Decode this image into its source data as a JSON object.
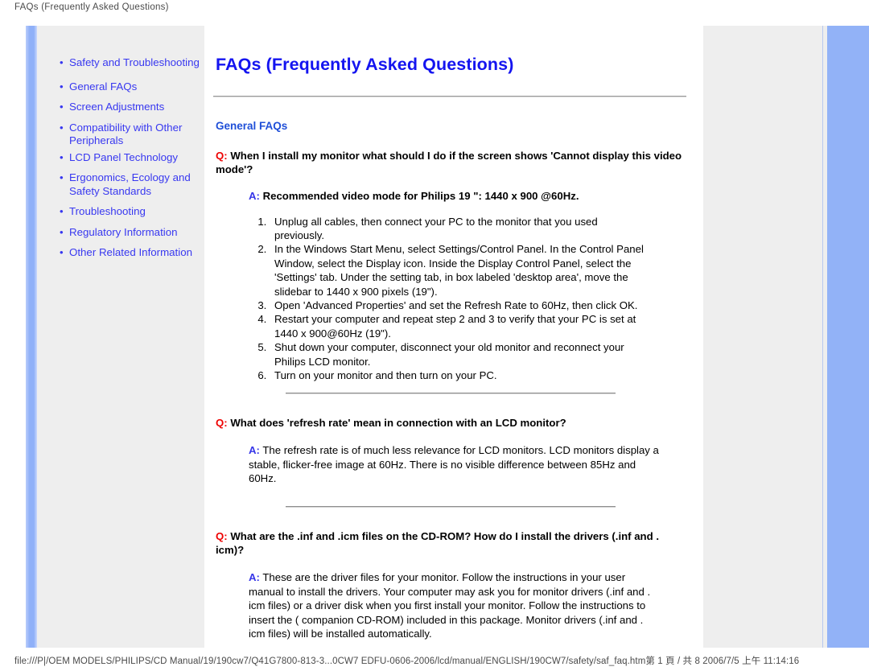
{
  "browser_header": {
    "title": "FAQs (Frequently Asked Questions)"
  },
  "sidebar": {
    "bullet_glyph": "•",
    "items": [
      {
        "label": "Safety and Troubleshooting"
      },
      {
        "label": "General FAQs"
      },
      {
        "label": "Screen Adjustments"
      },
      {
        "label": "Compatibility with Other Peripherals"
      },
      {
        "label": "LCD Panel Technology"
      },
      {
        "label": "Ergonomics, Ecology and Safety Standards"
      },
      {
        "label": "Troubleshooting"
      },
      {
        "label": "Regulatory Information"
      },
      {
        "label": "Other Related Information"
      }
    ]
  },
  "main": {
    "page_title": "FAQs (Frequently Asked Questions)",
    "section_title": "General FAQs",
    "q_prefix": "Q:",
    "a_prefix": "A:",
    "faqs": [
      {
        "question": "When I install my monitor what should I do if the screen shows 'Cannot display this video mode'?",
        "answer_bold": "Recommended video mode for Philips 19 \": 1440 x 900 @60Hz.",
        "steps": [
          "Unplug all cables, then connect your PC to the monitor that you used previously.",
          "In the Windows Start Menu, select Settings/Control Panel. In the Control Panel Window, select the Display icon. Inside the Display Control Panel, select the 'Settings' tab. Under the setting tab, in box labeled 'desktop area', move the slidebar to 1440 x 900 pixels (19\").",
          "Open 'Advanced Properties' and set the Refresh Rate to 60Hz, then click OK.",
          "Restart your computer and repeat step 2 and 3 to verify that your PC is set at 1440 x 900@60Hz (19\").",
          "Shut down your computer, disconnect your old monitor and reconnect your Philips LCD monitor.",
          "Turn on your monitor and then turn on your PC."
        ]
      },
      {
        "question": "What does 'refresh rate' mean in connection with an LCD monitor?",
        "answer": "The refresh rate is of much less relevance for LCD monitors. LCD monitors display a stable, flicker-free image at 60Hz. There is no visible difference between 85Hz and 60Hz."
      },
      {
        "question": "What are the .inf and .icm files on the CD-ROM? How do I install the drivers (.inf and . icm)?",
        "answer": "These are the driver files for your monitor. Follow the instructions in your user manual to install the drivers. Your computer may ask you for monitor drivers (.inf and . icm files) or a driver disk when you first install your monitor. Follow the instructions to insert the ( companion CD-ROM) included in this package. Monitor drivers (.inf and . icm files) will be installed automatically."
      }
    ]
  },
  "footer": {
    "path": "file:///P|/OEM MODELS/PHILIPS/CD Manual/19/190cw7/Q41G7800-813-3...0CW7 EDFU-0606-2006/lcd/manual/ENGLISH/190CW7/safety/saf_faq.htm",
    "page_info": "第 1 頁 / 共 8",
    "timestamp": "2006/7/5 上午 11:14:16"
  },
  "colors": {
    "link_blue": "#3838f0",
    "title_blue": "#1414f0",
    "section_blue": "#1f4fd8",
    "q_red": "#ee0000",
    "a_blue": "#3535e8",
    "panel_gray": "#eeeeee",
    "stripe_blue": "#92b2f7"
  }
}
